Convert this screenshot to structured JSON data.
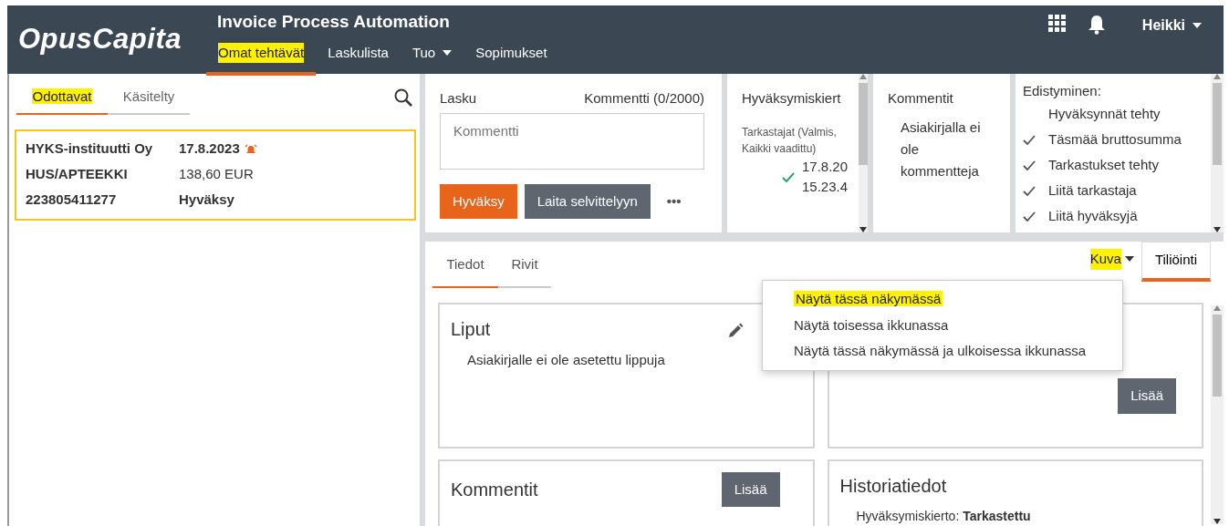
{
  "app": {
    "logo": "OpusCapita",
    "title": "Invoice Process Automation"
  },
  "nav": [
    {
      "label": "Omat tehtävät",
      "selected": true,
      "highlighted": true,
      "kind": "link"
    },
    {
      "label": "Laskulista",
      "selected": false,
      "highlighted": false,
      "kind": "link"
    },
    {
      "label": "Tuo",
      "selected": false,
      "highlighted": false,
      "kind": "dropdown"
    },
    {
      "label": "Sopimukset",
      "selected": false,
      "highlighted": false,
      "kind": "link"
    }
  ],
  "user": {
    "name": "Heikki"
  },
  "task_tabs": [
    {
      "label": "Odottavat",
      "selected": true,
      "highlighted": true
    },
    {
      "label": "Käsitelty",
      "selected": false,
      "highlighted": false
    }
  ],
  "tasks": [
    {
      "selected": true,
      "overdue": true,
      "supplier": "HYKS-instituutti Oy",
      "due_date": "17.8.2023",
      "buyer": "HUS/APTEEKKI",
      "amount": "138,60 EUR",
      "invoice_number": "223805411277",
      "action": "Hyväksy"
    }
  ],
  "comment_panel": {
    "label": "Lasku",
    "counter": "Kommentti (0/2000)",
    "placeholder": "Kommentti",
    "more": "•••",
    "buttons": [
      {
        "label": "Hyväksy",
        "kind": "primary"
      },
      {
        "label": "Laita selvittelyyn",
        "kind": "secondary"
      }
    ]
  },
  "approval_panel": {
    "title": "Hyväksymiskiert",
    "group": "Tarkastajat (Valmis, Kaikki vaadittu)",
    "entries": [
      {
        "done": true,
        "date": "17.8.20",
        "time": "15.23.4"
      }
    ]
  },
  "comments_panel": {
    "title": "Kommentit",
    "empty_text": "Asiakirjalla ei ole kommentteja"
  },
  "progress_panel": {
    "title": "Edistyminen:",
    "steps": [
      {
        "label": "Hyväksynnät tehty",
        "done": false
      },
      {
        "label": "Täsmää bruttosumma",
        "done": true
      },
      {
        "label": "Tarkastukset tehty",
        "done": true
      },
      {
        "label": "Liitä tarkastaja",
        "done": true
      },
      {
        "label": "Liitä hyväksyjä",
        "done": true
      }
    ]
  },
  "detail_tabs": [
    {
      "label": "Tiedot",
      "selected": true
    },
    {
      "label": "Rivit",
      "selected": false
    }
  ],
  "image_menu": {
    "label": "Kuva",
    "highlighted": true,
    "expanded": true,
    "items": [
      {
        "label": "Näytä tässä näkymässä",
        "highlighted": true
      },
      {
        "label": "Näytä toisessa ikkunassa",
        "highlighted": false
      },
      {
        "label": "Näytä tässä näkymässä ja ulkoisessa ikkunassa",
        "highlighted": false
      }
    ]
  },
  "side_tabs": [
    {
      "label": "Tiliöinti",
      "selected": true
    }
  ],
  "cards": [
    {
      "kind": "text",
      "title": "Liput",
      "text": "Asiakirjalle ei ole asetettu lippuja",
      "editable": true
    },
    {
      "kind": "button",
      "button": "Lisää"
    },
    {
      "kind": "header-button",
      "title": "Kommentit",
      "button": "Lisää"
    },
    {
      "kind": "text",
      "title": "Historiatiedot",
      "text": "Hyväksymiskierto: **Tarkastettu**",
      "editable": false
    }
  ]
}
